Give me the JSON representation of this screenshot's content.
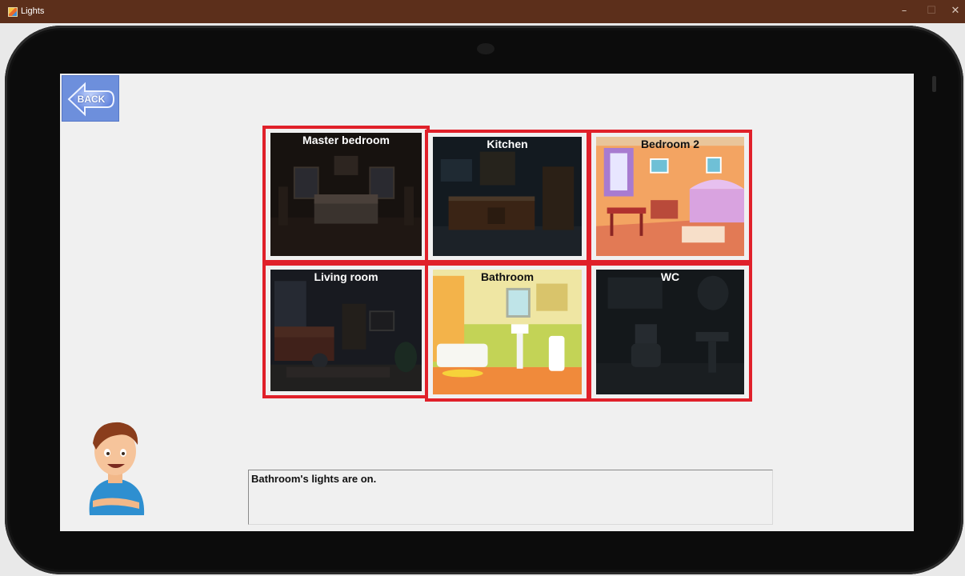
{
  "window": {
    "title": "Lights",
    "min_glyph": "–",
    "max_glyph": "☐",
    "close_glyph": "✕",
    "icon": "app-grid-icon"
  },
  "toolbar": {
    "back_label": "BACK",
    "back_icon": "back-arrow-icon"
  },
  "rooms": [
    {
      "id": "master-bedroom",
      "label": "Master bedroom",
      "lights_on": false
    },
    {
      "id": "kitchen",
      "label": "Kitchen",
      "lights_on": false
    },
    {
      "id": "bedroom-2",
      "label": "Bedroom 2",
      "lights_on": true
    },
    {
      "id": "living-room",
      "label": "Living room",
      "lights_on": false
    },
    {
      "id": "bathroom",
      "label": "Bathroom",
      "lights_on": true
    },
    {
      "id": "wc",
      "label": "WC",
      "lights_on": false
    }
  ],
  "status": {
    "message": "Bathroom's lights are on."
  },
  "colors": {
    "tile_border": "#e0202a",
    "titlebar": "#5c2f1b",
    "back_button": "#6d8fdc"
  },
  "mascot_icon": "boy-mascot-icon"
}
